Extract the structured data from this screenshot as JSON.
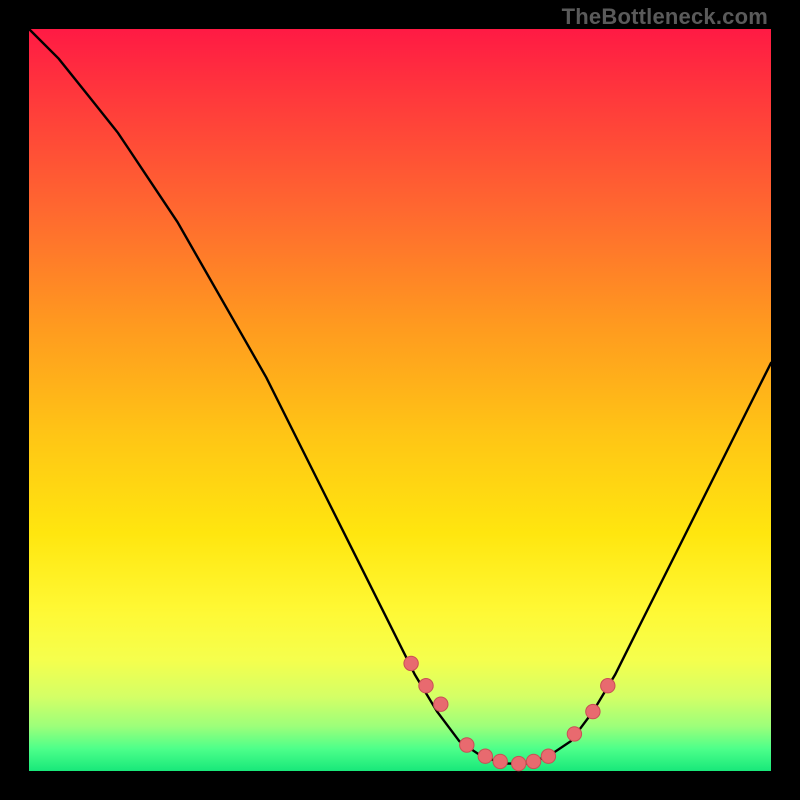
{
  "watermark": "TheBottleneck.com",
  "colors": {
    "frame": "#000000",
    "curve_stroke": "#000000",
    "marker_fill": "#e86a6f",
    "marker_stroke": "#c94f55"
  },
  "chart_data": {
    "type": "line",
    "title": "",
    "xlabel": "",
    "ylabel": "",
    "xlim": [
      0,
      100
    ],
    "ylim": [
      0,
      100
    ],
    "grid": false,
    "legend_position": "none",
    "series": [
      {
        "name": "bottleneck-curve",
        "x": [
          0,
          4,
          8,
          12,
          16,
          20,
          24,
          28,
          32,
          36,
          40,
          44,
          48,
          52,
          55,
          58,
          61,
          64,
          67,
          70,
          73,
          76,
          79,
          82,
          85,
          88,
          91,
          94,
          97,
          100
        ],
        "y": [
          100,
          96,
          91,
          86,
          80,
          74,
          67,
          60,
          53,
          45,
          37,
          29,
          21,
          13,
          8,
          4,
          2,
          1,
          1,
          2,
          4,
          8,
          13,
          19,
          25,
          31,
          37,
          43,
          49,
          55
        ]
      }
    ],
    "markers": {
      "name": "highlight-dots",
      "x": [
        51.5,
        53.5,
        55.5,
        59.0,
        61.5,
        63.5,
        66.0,
        68.0,
        70.0,
        73.5,
        76.0,
        78.0
      ],
      "y": [
        14.5,
        11.5,
        9.0,
        3.5,
        2.0,
        1.3,
        1.0,
        1.3,
        2.0,
        5.0,
        8.0,
        11.5
      ]
    }
  }
}
